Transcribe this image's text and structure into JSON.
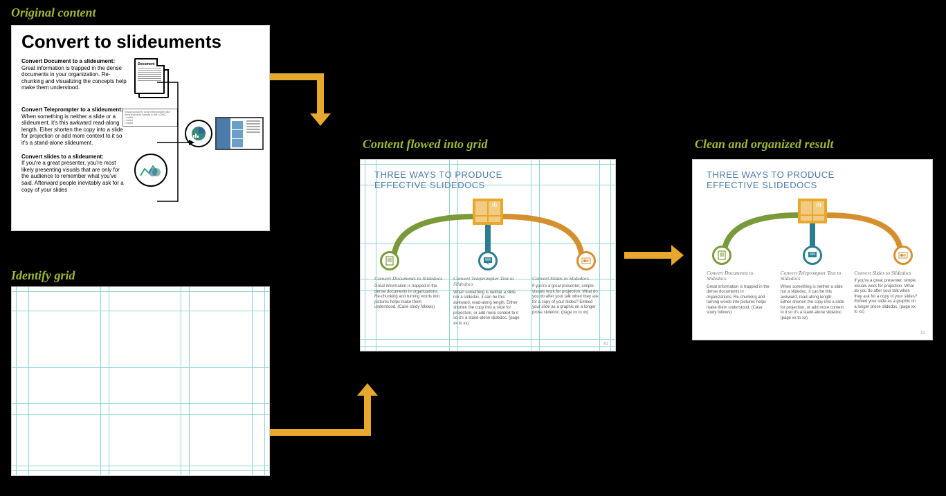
{
  "labels": {
    "original": "Original content",
    "grid": "Identify grid",
    "flowed": "Content flowed into grid",
    "clean": "Clean and organized result"
  },
  "original_slide": {
    "title": "Convert to slideuments",
    "sections": [
      {
        "heading": "Convert Document to a slideument:",
        "body": "Great information is trapped in the dense documents in your organization. Re-chunking and visualizing the concepts help make them understood.",
        "doc_label": "Document"
      },
      {
        "heading": "Convert Teleprompter to a slideument:",
        "body": "When something is neither a slide or a slideument, it's this awkward read-along length. Eiher shorten the copy into a slide for projection or add more context to it so it's a stand-alone slideument."
      },
      {
        "heading": "Convert slides to a slideument:",
        "body": "If you're a great presenter, you're most likely presenting visuals that are only for the audience to remember what you've said. Afterward people inevitably ask for a copy of your slides"
      }
    ]
  },
  "result_slide": {
    "title_line1": "THREE WAYS TO PRODUCE",
    "title_line2": "EFFECTIVE SLIDEDOCS",
    "page_num": "31",
    "columns": [
      {
        "title": "Convert Documents to Slidedocs",
        "body": "Great information is trapped in the dense documents in organizations. Re-chunking and turning words into pictures helps make them understood. (Case study follows)"
      },
      {
        "title": "Convert Teleprompter Text to Slidedocs",
        "body": "When something is neither a slide nor a slidedoc, it can be this awkward, read-along length. Either shorten the copy into a slide for projection, or add more context to it so it's a stand-alone slidedoc. (page xx to xx)"
      },
      {
        "title": "Convert Slides to Slidedocs",
        "body": "If you're a great presenter, simple visuals work for projection. What do you do after your talk when they ask for a copy of your slides? Embed your slide as a graphic on a longer prose slidedoc. (page xx to xx)"
      }
    ]
  },
  "colors": {
    "accent_label": "#a0b830",
    "arrow_yellow": "#e8a82e",
    "slide_blue": "#4b7ba8",
    "grid_cyan": "#8dd3d6",
    "green": "#7a9a3a",
    "teal": "#2a7f8e",
    "orange": "#d4902e"
  }
}
